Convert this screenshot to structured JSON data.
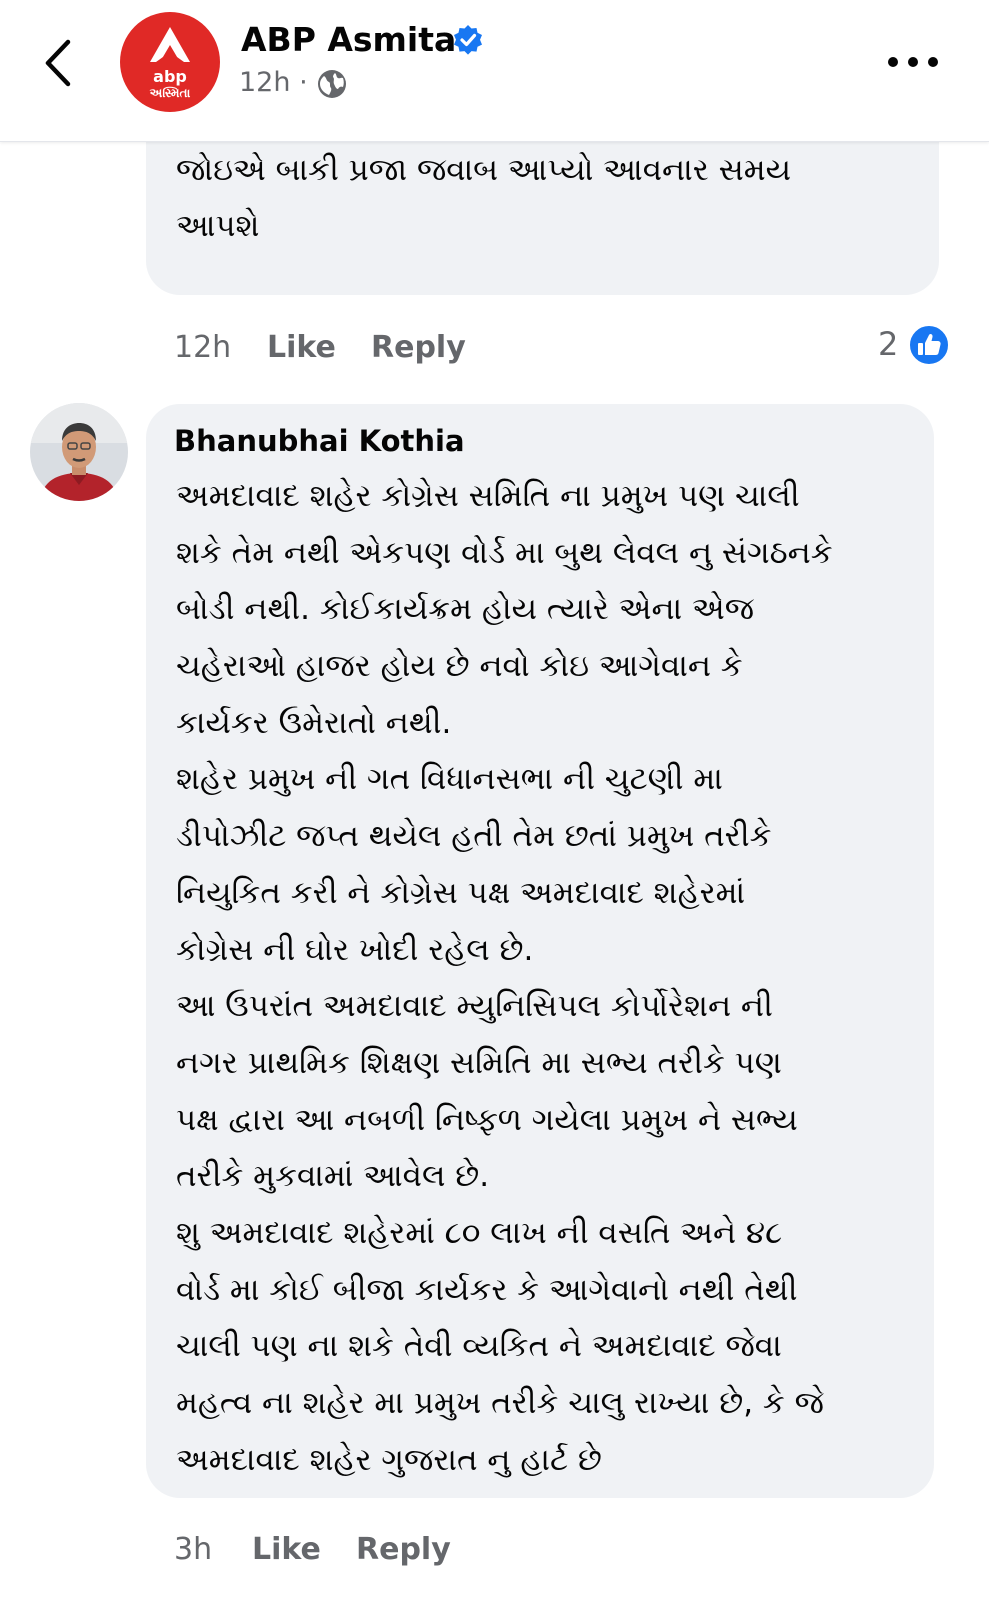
{
  "header": {
    "page_name": "ABP Asmita",
    "time": "12h",
    "separator": "·",
    "logo_text_top": "abp",
    "logo_text_bottom": "અસ્મિતા",
    "colors": {
      "brand": "#e02926",
      "verified": "#1877f2"
    }
  },
  "comment1": {
    "lines": [
      "જોઇએ બાકી પ્રજા જવાબ આપ્યો આવનાર સમય",
      "આપશે"
    ],
    "time": "12h",
    "like_label": "Like",
    "reply_label": "Reply",
    "reaction_count": "2"
  },
  "comment2": {
    "author": "Bhanubhai Kothia",
    "lines": [
      "અમદાવાદ શહેર કોગ્રેસ સમિતિ ના પ્રમુખ પણ ચાલી",
      "શકે તેમ નથી એકપણ વોર્ડ મા બુથ લેવલ નુ સંગઠનકે",
      "બોડી નથી. કોઈકાર્યક્રમ હોય ત્યારે એના એજ",
      "ચહેરાઓ હાજર હોય છે નવો કોઇ  આગેવાન કે",
      "કાર્યકર ઉમેરાતો નથી.",
      "શહેર પ્રમુખ ની ગત વિધાનસભા ની ચુટણી મા",
      "ડીપોઝીટ જપ્ત થયેલ હતી તેમ છતાં પ્રમુખ તરીકે",
      "નિયુકિત કરી ને કોગ્રેસ પક્ષ  અમદાવાદ શહેરમાં",
      "કોગ્રેસ ની ઘોર ખોદી રહેલ  છે.",
      "આ ઉપરાંત અમદાવાદ મ્યુનિસિપલ કોર્પોરેશન ની",
      "નગર પ્રાથમિક શિક્ષણ સમિતિ મા સભ્ય તરીકે પણ",
      "પક્ષ દ્વારા આ નબળી નિષ્ફળ ગયેલા પ્રમુખ ને સભ્ય",
      "તરીકે મુકવામાં આવેલ છે.",
      "શુ અમદાવાદ શહેરમાં ૮૦ લાખ ની વસતિ અને ૪૮",
      "વોર્ડ મા કોઈ બીજા કાર્યકર કે આગેવાનો નથી તેથી",
      "ચાલી પણ ના શકે તેવી વ્યકિત ને  અમદાવાદ જેવા",
      "મહત્વ ના શહેર મા પ્રમુખ તરીકે ચાલુ રાખ્યા છે, કે જે",
      "અમદાવાદ શહેર ગુજરાત નુ હાર્ટ છે"
    ],
    "time": "3h",
    "like_label": "Like",
    "reply_label": "Reply"
  }
}
